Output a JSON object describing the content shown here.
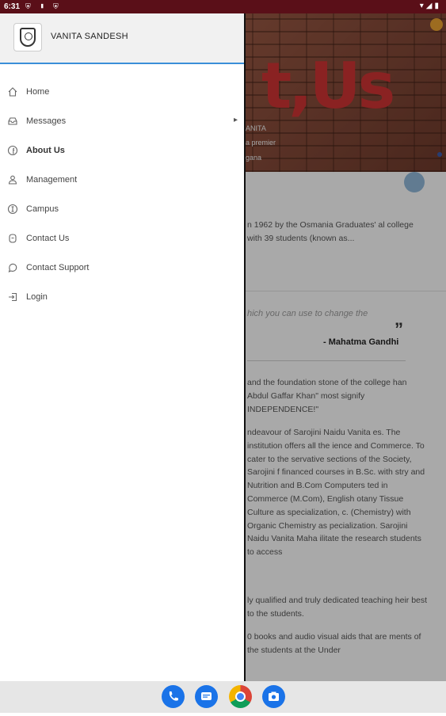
{
  "status_bar": {
    "time": "6:31",
    "left_icons": "⛨ ▮ ⛨",
    "right_icons": "▾◢▮"
  },
  "drawer": {
    "title": "VANITA SANDESH",
    "items": [
      {
        "label": "Home",
        "icon": "home-icon"
      },
      {
        "label": "Messages",
        "icon": "inbox-icon",
        "has_submenu": true
      },
      {
        "label": "About Us",
        "icon": "facebook-icon",
        "active": true
      },
      {
        "label": "Management",
        "icon": "user-group-icon"
      },
      {
        "label": "Campus",
        "icon": "building-icon"
      },
      {
        "label": "Contact Us",
        "icon": "contact-icon"
      },
      {
        "label": "Contact Support",
        "icon": "whatsapp-icon"
      },
      {
        "label": "Login",
        "icon": "login-icon"
      }
    ]
  },
  "background": {
    "hero_text": "t,Us",
    "hero_captions": [
      "ANITA",
      "a premier",
      "gana"
    ],
    "para1": "n 1962 by the Osmania Graduates' al college with 39 students (known as...",
    "quote": "hich you can use to change the",
    "quote_mark": "”",
    "quote_author": "- Mahatma Gandhi",
    "para2": "and the foundation stone of the college han Abdul Gaffar Khan\" most signify INDEPENDENCE!\"",
    "para3": "ndeavour of Sarojini Naidu Vanita es. The institution offers all the ience and Commerce. To cater to the servative sections of the Society, Sarojini f financed courses in B.Sc. with stry and Nutrition and B.Com Computers ted in Commerce (M.Com), English otany Tissue Culture as specialization, c. (Chemistry) with Organic Chemistry as pecialization. Sarojini Naidu Vanita Maha ilitate the research students to access",
    "para4": "ly qualified and truly dedicated teaching heir best to the students.",
    "para5": "0 books and audio visual aids that are ments of the students at the Under"
  },
  "dock": {
    "apps": [
      "phone-icon",
      "messages-icon",
      "chrome-icon",
      "camera-icon"
    ]
  }
}
